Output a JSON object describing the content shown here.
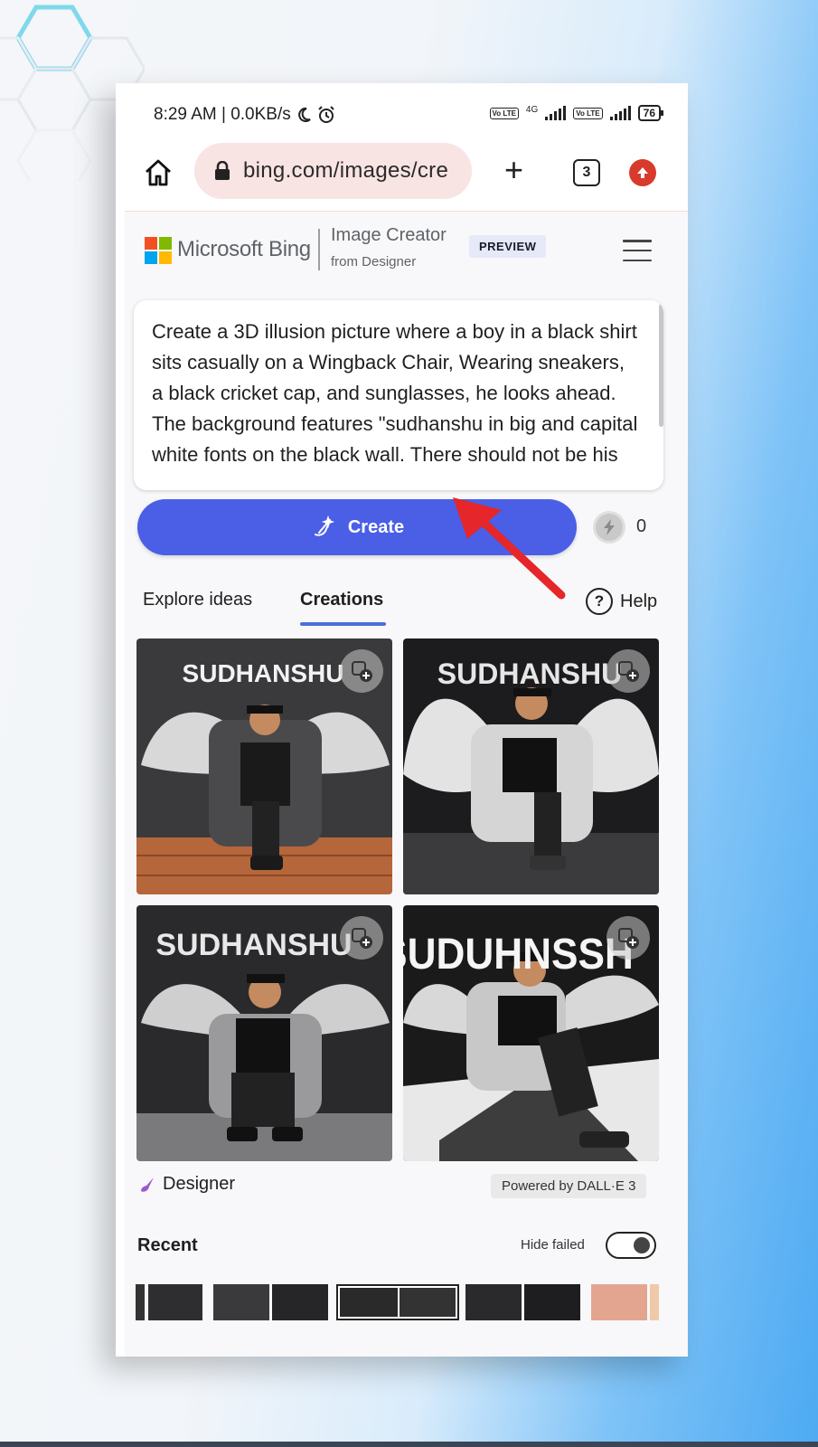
{
  "status_bar": {
    "time_speed": "8:29 AM | 0.0KB/s",
    "network": "4G",
    "volte": "Vo LTE",
    "battery": "76"
  },
  "browser": {
    "url": "bing.com/images/cre",
    "tab_count": "3"
  },
  "header": {
    "brand": "Microsoft Bing",
    "title": "Image Creator",
    "subtitle": "from Designer",
    "badge": "PREVIEW"
  },
  "prompt": {
    "text": "Create a 3D illusion picture where a boy in a black shirt sits casually on a Wingback Chair, Wearing sneakers, a black cricket cap, and sunglasses, he looks ahead. The background features \"sudhanshu in big and capital white fonts on the black wall. There should not be his"
  },
  "create": {
    "label": "Create",
    "boosts": "0"
  },
  "tabs": {
    "explore": "Explore ideas",
    "creations": "Creations",
    "help": "Help"
  },
  "images": [
    {
      "caption": "SUDHANSHU"
    },
    {
      "caption": "SUDHANSHU"
    },
    {
      "caption": "SUDHANSHU"
    },
    {
      "caption": "SUDUHNSSH"
    }
  ],
  "footer": {
    "designer": "Designer",
    "powered": "Powered by DALL·E 3"
  },
  "recent": {
    "label": "Recent",
    "hide_failed": "Hide failed",
    "hide_failed_on": true
  },
  "colors": {
    "create_button": "#4a5fe6",
    "tab_underline": "#4a6fd6",
    "annotation_arrow": "#e5262a"
  }
}
